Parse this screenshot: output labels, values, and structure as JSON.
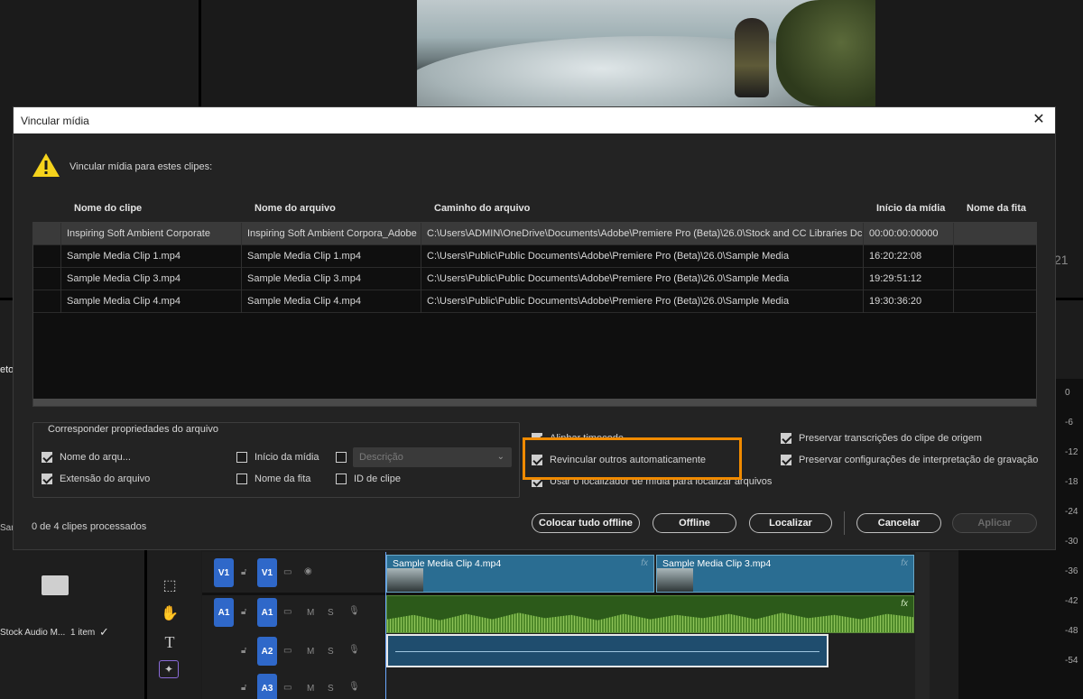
{
  "dialog": {
    "title": "Vincular mídia",
    "close_glyph": "✕",
    "warning_icon": "warning-triangle-icon",
    "warning_text": "Vincular mídia para estes clipes:",
    "columns": [
      "Nome do clipe",
      "Nome do arquivo",
      "Caminho do arquivo",
      "Início da mídia",
      "Nome da fita"
    ],
    "rows": [
      {
        "clip": "Inspiring Soft Ambient Corporate",
        "file": "Inspiring Soft Ambient Corpora_Adobe",
        "path": "C:\\Users\\ADMIN\\OneDrive\\Documents\\Adobe\\Premiere Pro (Beta)\\26.0\\Stock and CC Libraries Dc",
        "start": "00:00:00:00000",
        "tape": ""
      },
      {
        "clip": "Sample Media Clip 1.mp4",
        "file": "Sample Media Clip 1.mp4",
        "path": "C:\\Users\\Public\\Public Documents\\Adobe\\Premiere Pro (Beta)\\26.0\\Sample Media",
        "start": "16:20:22:08",
        "tape": ""
      },
      {
        "clip": "Sample Media Clip 3.mp4",
        "file": "Sample Media Clip 3.mp4",
        "path": "C:\\Users\\Public\\Public Documents\\Adobe\\Premiere Pro (Beta)\\26.0\\Sample Media",
        "start": "19:29:51:12",
        "tape": ""
      },
      {
        "clip": "Sample Media Clip 4.mp4",
        "file": "Sample Media Clip 4.mp4",
        "path": "C:\\Users\\Public\\Public Documents\\Adobe\\Premiere Pro (Beta)\\26.0\\Sample Media",
        "start": "19:30:36:20",
        "tape": ""
      }
    ],
    "match_group": {
      "legend": "Corresponder propriedades do arquivo",
      "file_name": {
        "label": "Nome do arqu...",
        "checked": true
      },
      "file_extension": {
        "label": "Extensão do arquivo",
        "checked": true
      },
      "media_start": {
        "label": "Início da mídia",
        "checked": false
      },
      "tape_name": {
        "label": "Nome da fita",
        "checked": false
      },
      "description": {
        "checked": false,
        "placeholder": "Descrição"
      },
      "clip_id": {
        "label": "ID de clipe",
        "checked": false
      }
    },
    "options": {
      "align_timecode": {
        "label": "Alinhar timecode",
        "checked": true
      },
      "relink_others": {
        "label": "Revincular outros automaticamente",
        "checked": true
      },
      "use_media_browser": {
        "label": "Usar o localizador de mídia para localizar arquivos",
        "checked": true
      },
      "preserve_transcripts": {
        "label": "Preservar transcrições do clipe de origem",
        "checked": true
      },
      "preserve_interpretation": {
        "label": "Preservar configurações de interpretação de gravação",
        "checked": true
      }
    },
    "status": "0 de 4 clipes processados",
    "buttons": {
      "offline_all": "Colocar tudo offline",
      "offline": "Offline",
      "locate": "Localizar",
      "cancel": "Cancelar",
      "apply": "Aplicar"
    },
    "highlight_color": "#f08a00"
  },
  "background": {
    "project_tab": "eto",
    "sample_label": "Sam",
    "bin_label": "Stock Audio M...",
    "item_count": "1 item",
    "ruler_number": "21",
    "tracks": {
      "v1_source": "V1",
      "v1": "V1",
      "a1_source": "A1",
      "a1": "A1",
      "a2": "A2",
      "a3": "A3",
      "mute": "M",
      "solo": "S"
    },
    "clips": {
      "clip4": "Sample Media Clip 4.mp4",
      "clip3": "Sample Media Clip 3.mp4",
      "fx": "fx"
    },
    "meter_ticks": [
      "0",
      "-6",
      "-12",
      "-18",
      "-24",
      "-30",
      "-36",
      "-42",
      "-48",
      "-54"
    ]
  }
}
